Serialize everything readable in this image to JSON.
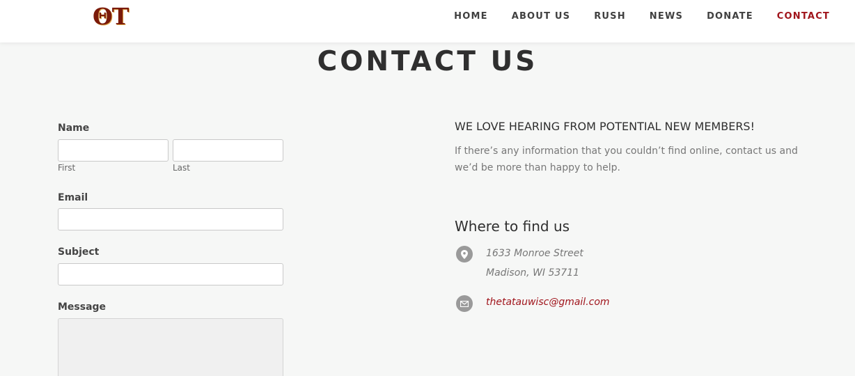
{
  "header": {
    "logo_text": "ΘΤ",
    "nav": [
      {
        "label": "HOME"
      },
      {
        "label": "ABOUT US"
      },
      {
        "label": "RUSH"
      },
      {
        "label": "NEWS"
      },
      {
        "label": "DONATE"
      },
      {
        "label": "CONTACT",
        "active": true
      }
    ]
  },
  "page": {
    "title": "CONTACT US"
  },
  "form": {
    "name_label": "Name",
    "first_label": "First",
    "last_label": "Last",
    "first_value": "",
    "last_value": "",
    "email_label": "Email",
    "email_value": "",
    "subject_label": "Subject",
    "subject_value": "",
    "message_label": "Message",
    "message_value": ""
  },
  "info": {
    "heading": "WE LOVE HEARING FROM POTENTIAL NEW MEMBERS!",
    "text": "If there’s any information that you couldn’t find online, contact us and we’d be more than happy to help.",
    "where_heading": "Where to find us",
    "address_line1": "1633 Monroe Street",
    "address_line2": "Madison, WI 53711",
    "email": "thetatauwisc@gmail.com",
    "location_icon": "map-marker-icon",
    "email_icon": "envelope-icon"
  },
  "colors": {
    "accent": "#a0141b",
    "background": "#f6f7f6",
    "logo": "#7a1a0a"
  }
}
